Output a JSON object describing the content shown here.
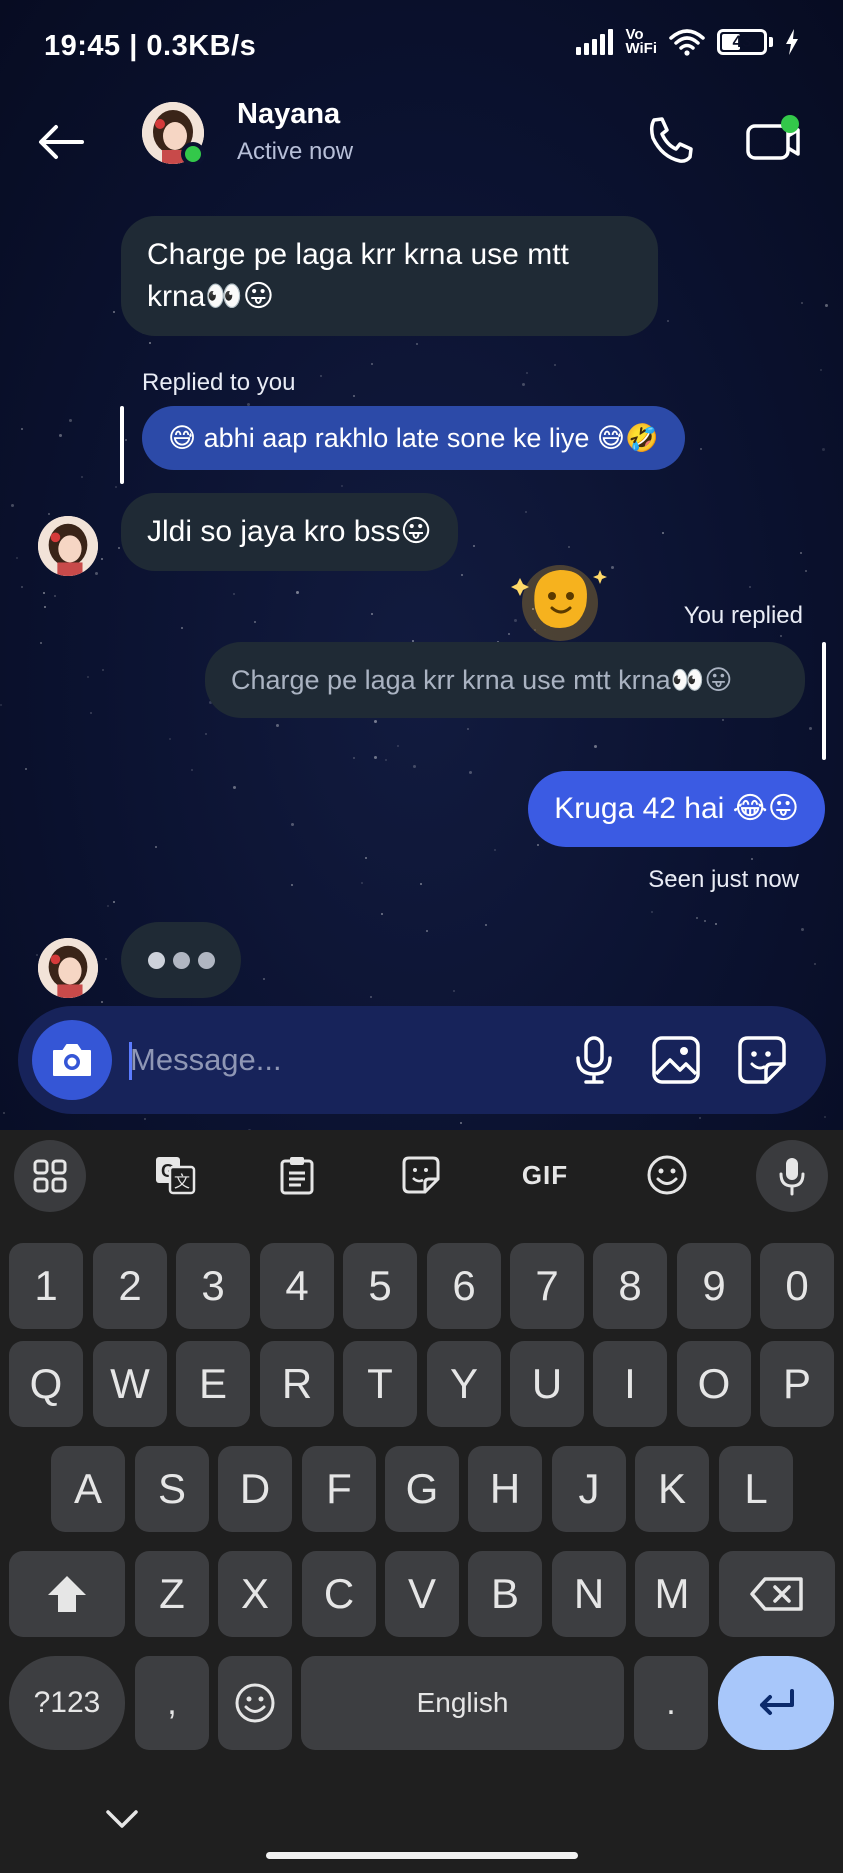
{
  "status_bar": {
    "time": "19:45 | 0.3KB/s",
    "network_label_top": "Vo",
    "network_label_bottom": "WiFi",
    "battery": "43"
  },
  "header": {
    "contact_name": "Nayana",
    "contact_status": "Active now"
  },
  "messages": {
    "m1": "Charge pe laga krr krna use mtt krna👀😛",
    "reply_label": "Replied to you",
    "quoted_in": "😅 abhi aap rakhlo late sone ke liye 😅🤣",
    "m2": "Jldi so jaya kro bss😛",
    "you_replied_label": "You replied",
    "quoted_out": "Charge pe laga krr krna use mtt krna👀😛",
    "m3": "Kruga 42 hai 😂😛",
    "seen": "Seen just now"
  },
  "composer": {
    "placeholder": "Message..."
  },
  "keyboard": {
    "number_row": [
      "1",
      "2",
      "3",
      "4",
      "5",
      "6",
      "7",
      "8",
      "9",
      "0"
    ],
    "row1": [
      "Q",
      "W",
      "E",
      "R",
      "T",
      "Y",
      "U",
      "I",
      "O",
      "P"
    ],
    "row2": [
      "A",
      "S",
      "D",
      "F",
      "G",
      "H",
      "J",
      "K",
      "L"
    ],
    "row3": [
      "Z",
      "X",
      "C",
      "V",
      "B",
      "N",
      "M"
    ],
    "symbols_key": "?123",
    "comma_key": ",",
    "space_key": "English",
    "period_key": ".",
    "gif_label": "GIF"
  },
  "colors": {
    "outgoing_bubble": "#3b5be3",
    "incoming_bubble": "#1f2a35",
    "quoted_incoming": "#2c4aa8",
    "online": "#33c84a",
    "enter_key": "#a8c7fa"
  }
}
